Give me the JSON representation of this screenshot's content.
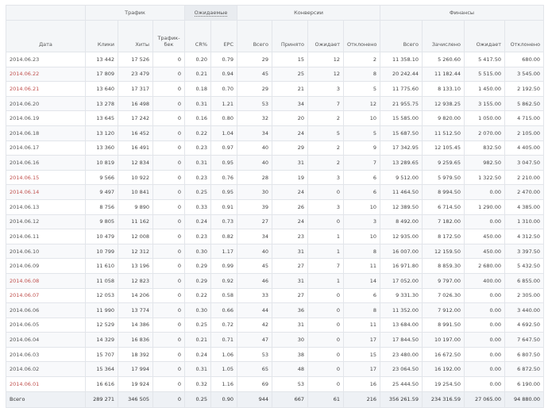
{
  "groups": {
    "traffic": "Трафик",
    "expected": "Ожидаемые",
    "conversions": "Конверсии",
    "finance": "Финансы"
  },
  "columns": [
    "Дата",
    "Клики",
    "Хиты",
    "Трафик-бек",
    "CR%",
    "EPC",
    "Всего",
    "Принято",
    "Ожидает",
    "Отклонено",
    "Всего",
    "Зачислено",
    "Ожидает",
    "Отклонено"
  ],
  "rows": [
    {
      "date": "2014.06.23",
      "weekend": false,
      "cells": [
        "13 442",
        "17 526",
        "0",
        "0.20",
        "0.79",
        "29",
        "15",
        "12",
        "2",
        "11 358.10",
        "5 260.60",
        "5 417.50",
        "680.00"
      ]
    },
    {
      "date": "2014.06.22",
      "weekend": true,
      "cells": [
        "17 809",
        "23 479",
        "0",
        "0.21",
        "0.94",
        "45",
        "25",
        "12",
        "8",
        "20 242.44",
        "11 182.44",
        "5 515.00",
        "3 545.00"
      ]
    },
    {
      "date": "2014.06.21",
      "weekend": true,
      "cells": [
        "13 640",
        "17 317",
        "0",
        "0.18",
        "0.70",
        "29",
        "21",
        "3",
        "5",
        "11 775.60",
        "8 133.10",
        "1 450.00",
        "2 192.50"
      ]
    },
    {
      "date": "2014.06.20",
      "weekend": false,
      "cells": [
        "13 278",
        "16 498",
        "0",
        "0.31",
        "1.21",
        "53",
        "34",
        "7",
        "12",
        "21 955.75",
        "12 938.25",
        "3 155.00",
        "5 862.50"
      ]
    },
    {
      "date": "2014.06.19",
      "weekend": false,
      "cells": [
        "13 645",
        "17 242",
        "0",
        "0.16",
        "0.80",
        "32",
        "20",
        "2",
        "10",
        "15 585.00",
        "9 820.00",
        "1 050.00",
        "4 715.00"
      ]
    },
    {
      "date": "2014.06.18",
      "weekend": false,
      "cells": [
        "13 120",
        "16 452",
        "0",
        "0.22",
        "1.04",
        "34",
        "24",
        "5",
        "5",
        "15 687.50",
        "11 512.50",
        "2 070.00",
        "2 105.00"
      ]
    },
    {
      "date": "2014.06.17",
      "weekend": false,
      "cells": [
        "13 360",
        "16 491",
        "0",
        "0.23",
        "0.97",
        "40",
        "29",
        "2",
        "9",
        "17 342.95",
        "12 105.45",
        "832.50",
        "4 405.00"
      ]
    },
    {
      "date": "2014.06.16",
      "weekend": false,
      "cells": [
        "10 819",
        "12 834",
        "0",
        "0.31",
        "0.95",
        "40",
        "31",
        "2",
        "7",
        "13 289.65",
        "9 259.65",
        "982.50",
        "3 047.50"
      ]
    },
    {
      "date": "2014.06.15",
      "weekend": true,
      "cells": [
        "9 566",
        "10 922",
        "0",
        "0.23",
        "0.76",
        "28",
        "19",
        "3",
        "6",
        "9 512.00",
        "5 979.50",
        "1 322.50",
        "2 210.00"
      ]
    },
    {
      "date": "2014.06.14",
      "weekend": true,
      "cells": [
        "9 497",
        "10 841",
        "0",
        "0.25",
        "0.95",
        "30",
        "24",
        "0",
        "6",
        "11 464.50",
        "8 994.50",
        "0.00",
        "2 470.00"
      ]
    },
    {
      "date": "2014.06.13",
      "weekend": false,
      "cells": [
        "8 756",
        "9 890",
        "0",
        "0.33",
        "0.91",
        "39",
        "26",
        "3",
        "10",
        "12 389.50",
        "6 714.50",
        "1 290.00",
        "4 385.00"
      ]
    },
    {
      "date": "2014.06.12",
      "weekend": false,
      "cells": [
        "9 805",
        "11 162",
        "0",
        "0.24",
        "0.73",
        "27",
        "24",
        "0",
        "3",
        "8 492.00",
        "7 182.00",
        "0.00",
        "1 310.00"
      ]
    },
    {
      "date": "2014.06.11",
      "weekend": false,
      "cells": [
        "10 479",
        "12 008",
        "0",
        "0.23",
        "0.82",
        "34",
        "23",
        "1",
        "10",
        "12 935.00",
        "8 172.50",
        "450.00",
        "4 312.50"
      ]
    },
    {
      "date": "2014.06.10",
      "weekend": false,
      "cells": [
        "10 799",
        "12 312",
        "0",
        "0.30",
        "1.17",
        "40",
        "31",
        "1",
        "8",
        "16 007.00",
        "12 159.50",
        "450.00",
        "3 397.50"
      ]
    },
    {
      "date": "2014.06.09",
      "weekend": false,
      "cells": [
        "11 610",
        "13 196",
        "0",
        "0.29",
        "0.99",
        "45",
        "27",
        "7",
        "11",
        "16 971.80",
        "8 859.30",
        "2 680.00",
        "5 432.50"
      ]
    },
    {
      "date": "2014.06.08",
      "weekend": true,
      "cells": [
        "11 058",
        "12 823",
        "0",
        "0.29",
        "0.92",
        "46",
        "31",
        "1",
        "14",
        "17 052.00",
        "9 797.00",
        "400.00",
        "6 855.00"
      ]
    },
    {
      "date": "2014.06.07",
      "weekend": true,
      "cells": [
        "12 053",
        "14 206",
        "0",
        "0.22",
        "0.58",
        "33",
        "27",
        "0",
        "6",
        "9 331.30",
        "7 026.30",
        "0.00",
        "2 305.00"
      ]
    },
    {
      "date": "2014.06.06",
      "weekend": false,
      "cells": [
        "11 990",
        "13 774",
        "0",
        "0.30",
        "0.66",
        "44",
        "36",
        "0",
        "8",
        "11 352.00",
        "7 912.00",
        "0.00",
        "3 440.00"
      ]
    },
    {
      "date": "2014.06.05",
      "weekend": false,
      "cells": [
        "12 529",
        "14 386",
        "0",
        "0.25",
        "0.72",
        "42",
        "31",
        "0",
        "11",
        "13 684.00",
        "8 991.50",
        "0.00",
        "4 692.50"
      ]
    },
    {
      "date": "2014.06.04",
      "weekend": false,
      "cells": [
        "14 329",
        "16 836",
        "0",
        "0.21",
        "0.71",
        "47",
        "30",
        "0",
        "17",
        "17 844.50",
        "10 197.00",
        "0.00",
        "7 647.50"
      ]
    },
    {
      "date": "2014.06.03",
      "weekend": false,
      "cells": [
        "15 707",
        "18 392",
        "0",
        "0.24",
        "1.06",
        "53",
        "38",
        "0",
        "15",
        "23 480.00",
        "16 672.50",
        "0.00",
        "6 807.50"
      ]
    },
    {
      "date": "2014.06.02",
      "weekend": false,
      "cells": [
        "15 364",
        "17 994",
        "0",
        "0.31",
        "1.05",
        "65",
        "48",
        "0",
        "17",
        "23 064.50",
        "16 192.00",
        "0.00",
        "6 872.50"
      ]
    },
    {
      "date": "2014.06.01",
      "weekend": true,
      "cells": [
        "16 616",
        "19 924",
        "0",
        "0.32",
        "1.16",
        "69",
        "53",
        "0",
        "16",
        "25 444.50",
        "19 254.50",
        "0.00",
        "6 190.00"
      ]
    }
  ],
  "totals": {
    "label": "Всего",
    "cells": [
      "289 271",
      "346 505",
      "0",
      "0.25",
      "0.90",
      "944",
      "667",
      "61",
      "216",
      "356 261.59",
      "234 316.59",
      "27 065.00",
      "94 880.00"
    ]
  }
}
